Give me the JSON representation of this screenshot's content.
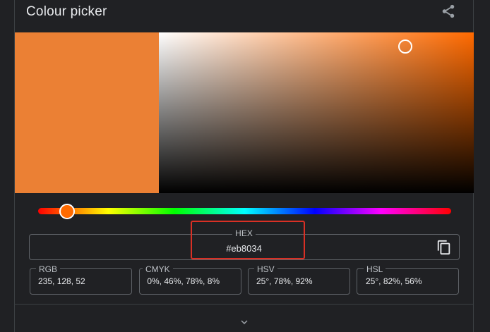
{
  "widget": {
    "title": "Colour picker",
    "share_icon": "share-icon",
    "selected_color": "#eb8034",
    "base_hue_color": "#ff6a00",
    "highlight_color": "#d93025"
  },
  "hex": {
    "label": "HEX",
    "value": "#eb8034",
    "copy_icon": "copy-icon"
  },
  "fields": [
    {
      "label": "RGB",
      "value": "235, 128, 52"
    },
    {
      "label": "CMYK",
      "value": " 0%, 46%, 78%, 8%"
    },
    {
      "label": "HSV",
      "value": "25°, 78%, 92%"
    },
    {
      "label": "HSL",
      "value": "25°, 82%, 56%"
    }
  ],
  "footer": {
    "expand_icon": "chevron-down-icon"
  }
}
